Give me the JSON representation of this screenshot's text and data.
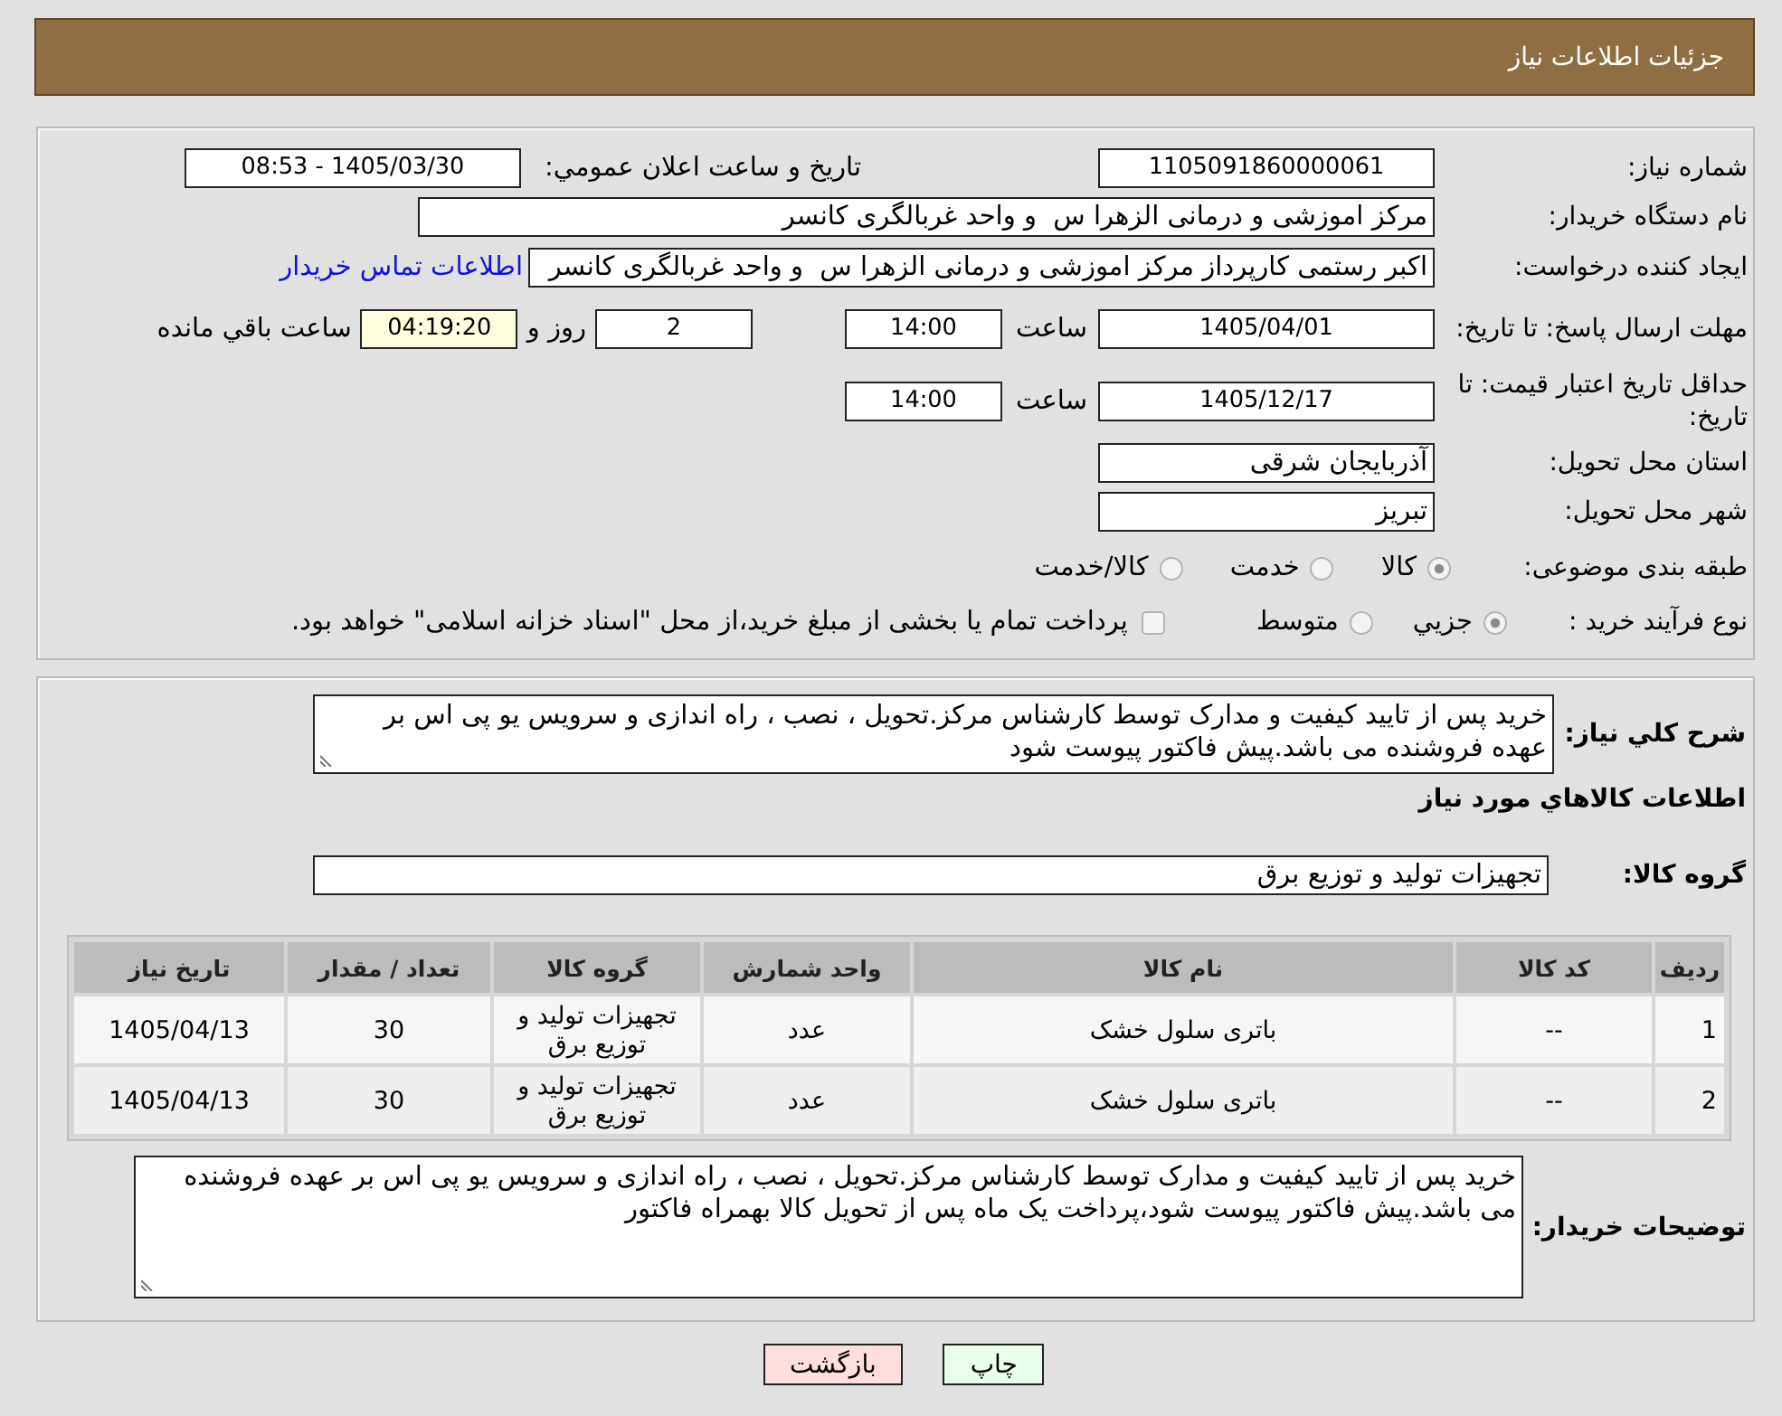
{
  "header": {
    "title": "جزئیات اطلاعات نیاز"
  },
  "need_info": {
    "need_number": {
      "label": "شماره نیاز:",
      "value": "1105091860000061"
    },
    "announce_date": {
      "label": "تاريخ و ساعت اعلان عمومي:",
      "value": "1405/03/30 - 08:53"
    },
    "buyer_org": {
      "label": "نام دستگاه خریدار:",
      "value": "مرکز اموزشی و درمانی الزهرا س  و واحد غربالگری کانسر"
    },
    "requester": {
      "label": "ایجاد کننده درخواست:",
      "value": "اکبر رستمی کارپرداز مرکز اموزشی و درمانی الزهرا س  و واحد غربالگری کانسر",
      "contact_link": "اطلاعات تماس خریدار"
    },
    "response_deadline": {
      "label": "مهلت ارسال پاسخ: تا تاریخ:",
      "date": "1405/04/01",
      "time_label": "ساعت",
      "time": "14:00",
      "days": "2",
      "days_label": "روز و",
      "remaining": "04:19:20",
      "remaining_label": "ساعت باقي مانده"
    },
    "price_validity": {
      "label": "حداقل تاریخ اعتبار قیمت: تا تاریخ:",
      "date": "1405/12/17",
      "time_label": "ساعت",
      "time": "14:00"
    },
    "province": {
      "label": "استان محل تحویل:",
      "value": "آذربایجان شرقی"
    },
    "city": {
      "label": "شهر محل تحویل:",
      "value": "تبریز"
    },
    "category": {
      "label": "طبقه بندی موضوعی:",
      "options": [
        {
          "label": "کالا",
          "selected": true
        },
        {
          "label": "خدمت",
          "selected": false
        },
        {
          "label": "کالا/خدمت",
          "selected": false
        }
      ]
    },
    "purchase_type": {
      "label": "نوع فرآیند خرید :",
      "options": [
        {
          "label": "جزيي",
          "selected": true
        },
        {
          "label": "متوسط",
          "selected": false
        }
      ],
      "treasury": {
        "label": "پرداخت تمام یا بخشی از مبلغ خرید،از محل \"اسناد خزانه اسلامی\" خواهد بود.",
        "checked": false
      }
    }
  },
  "goods": {
    "description": {
      "label": "شرح كلي نياز:",
      "value": "خرید پس از تایید کیفیت و مدارک توسط کارشناس مرکز.تحویل ، نصب ، راه اندازی و سرویس یو پی اس بر عهده فروشنده می باشد.پیش فاکتور پیوست شود"
    },
    "heading": "اطلاعات كالاهاي مورد نياز",
    "group": {
      "label": "گروه کالا:",
      "value": "تجهیزات تولید و توزیع برق"
    },
    "table": {
      "columns": [
        "ردیف",
        "کد کالا",
        "نام کالا",
        "واحد شمارش",
        "گروه کالا",
        "تعداد / مقدار",
        "تاریخ نیاز"
      ],
      "rows": [
        {
          "row": "1",
          "code": "--",
          "name": "باتری سلول خشک",
          "unit": "عدد",
          "group": "تجهیزات تولید و توزیع برق",
          "quantity": "30",
          "date": "1405/04/13"
        },
        {
          "row": "2",
          "code": "--",
          "name": "باتری سلول خشک",
          "unit": "عدد",
          "group": "تجهیزات تولید و توزیع برق",
          "quantity": "30",
          "date": "1405/04/13"
        }
      ]
    },
    "buyer_notes": {
      "label": "توضیحات خریدار:",
      "value": "خرید پس از تایید کیفیت و مدارک توسط کارشناس مرکز.تحویل ، نصب ، راه اندازی و سرویس یو پی اس بر عهده فروشنده می باشد.پیش فاکتور پیوست شود،پرداخت یک ماه پس از تحویل کالا بهمراه فاکتور"
    }
  },
  "buttons": [
    {
      "kind": "print",
      "label": "چاپ"
    },
    {
      "kind": "back",
      "label": "بازگشت"
    }
  ]
}
